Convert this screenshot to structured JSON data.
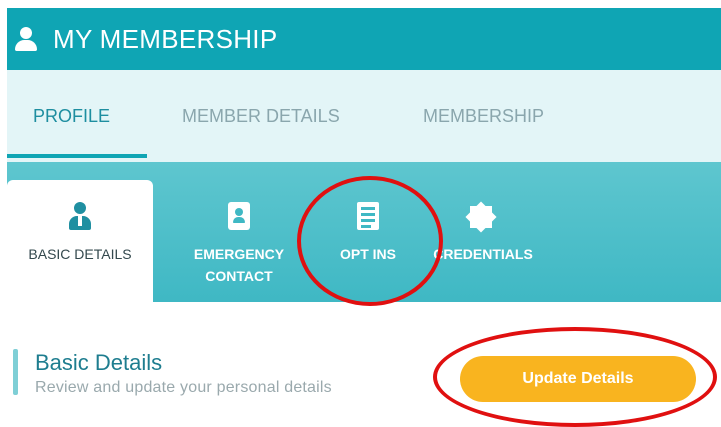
{
  "header": {
    "title": "MY MEMBERSHIP",
    "icon": "user-icon"
  },
  "top_tabs": [
    {
      "label": "PROFILE",
      "active": true
    },
    {
      "label": "MEMBER DETAILS",
      "active": false
    },
    {
      "label": "MEMBERSHIP",
      "active": false
    }
  ],
  "section_tabs": [
    {
      "label": "BASIC DETAILS",
      "icon": "person-tie-icon",
      "active": true
    },
    {
      "line1": "EMERGENCY",
      "line2": "CONTACT",
      "icon": "contact-card-icon",
      "active": false
    },
    {
      "label": "OPT INS",
      "icon": "checklist-icon",
      "active": false
    },
    {
      "label": "CREDENTIALS",
      "icon": "badge-icon",
      "active": false
    }
  ],
  "content": {
    "title": "Basic Details",
    "subtitle": "Review and update your personal details",
    "update_button_label": "Update Details"
  },
  "colors": {
    "header": "#0fa5b4",
    "top_tabs_bg": "#e3f5f7",
    "section_tabs_bg": "#3fb8c4",
    "button": "#f9b41f",
    "annotation": "#e01010"
  }
}
